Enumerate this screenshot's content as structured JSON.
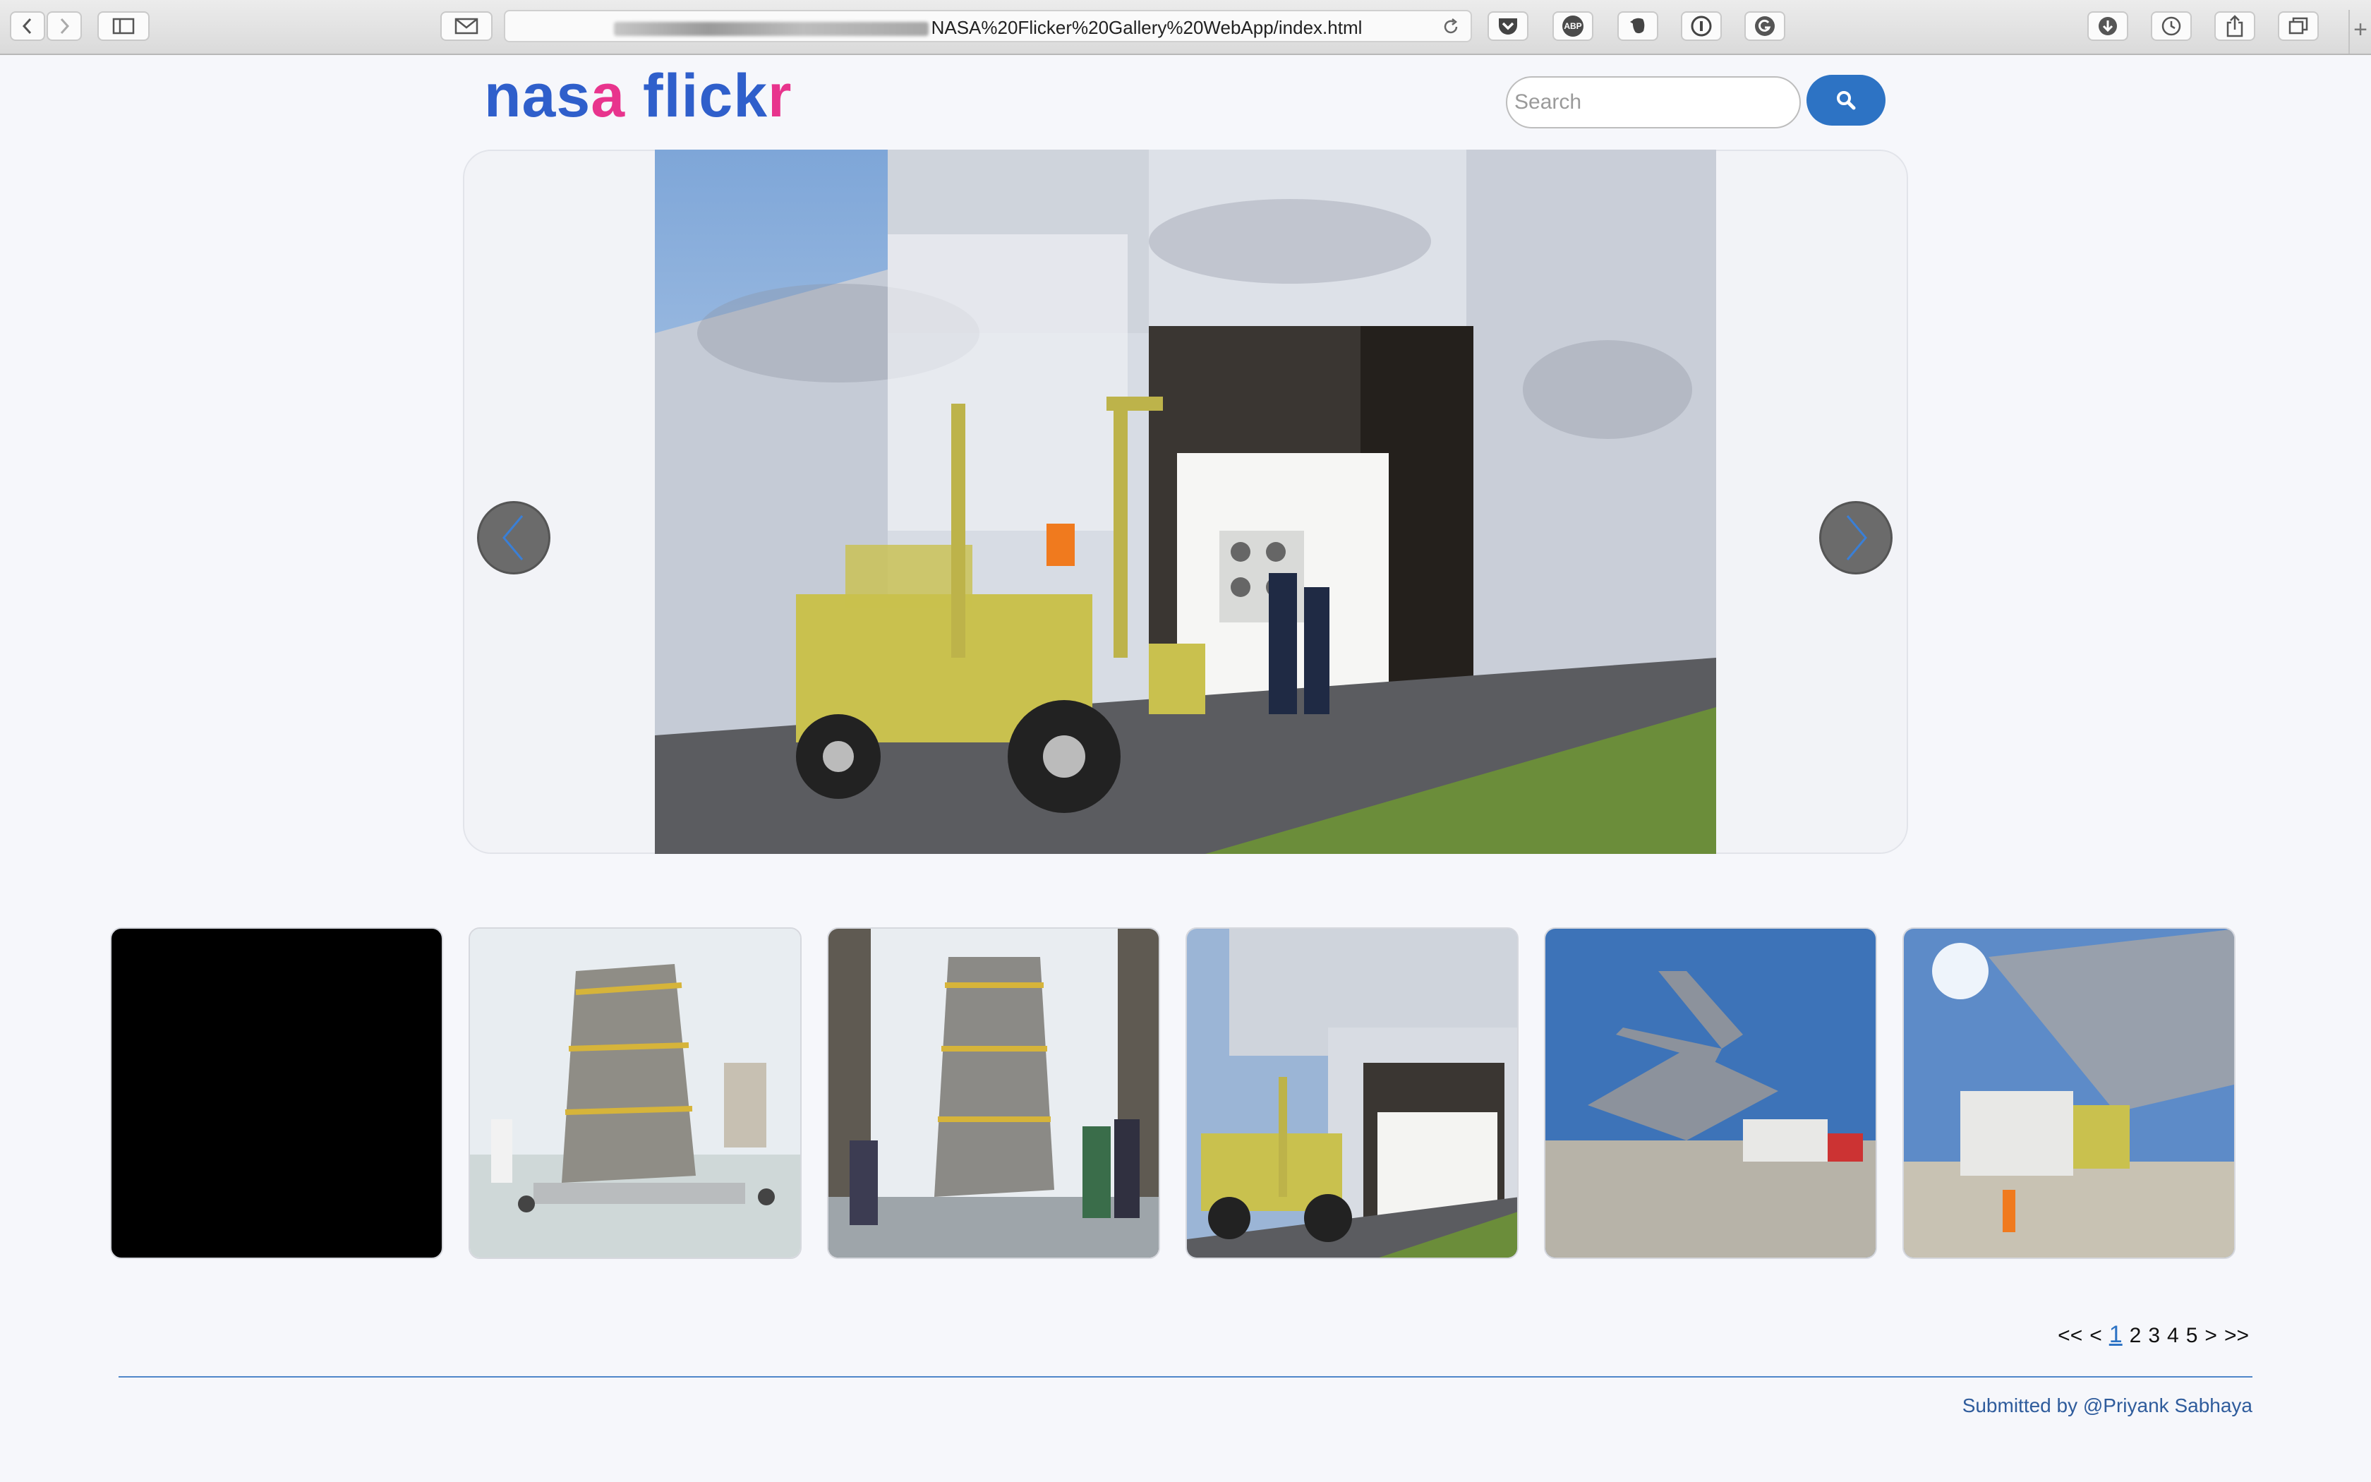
{
  "browser": {
    "url_suffix": "NASA%20Flicker%20Gallery%20WebApp/index.html",
    "extensions": [
      "pocket-icon",
      "abp-icon",
      "evernote-icon",
      "1password-icon",
      "grammarly-icon"
    ],
    "abp_label": "ABP"
  },
  "logo": {
    "part1": "nas",
    "part2": "a",
    "part3": " flick",
    "part4": "r"
  },
  "search": {
    "placeholder": "Search"
  },
  "pagination": {
    "first": "<<",
    "prev": "<",
    "pages": [
      "1",
      "2",
      "3",
      "4",
      "5"
    ],
    "current": "1",
    "next": ">",
    "last": ">>"
  },
  "footer": {
    "text": "Submitted by @Priyank Sabhaya"
  },
  "colors": {
    "brand_blue": "#2f5fcb",
    "brand_pink": "#e8348d",
    "accent": "#2d73c4"
  }
}
